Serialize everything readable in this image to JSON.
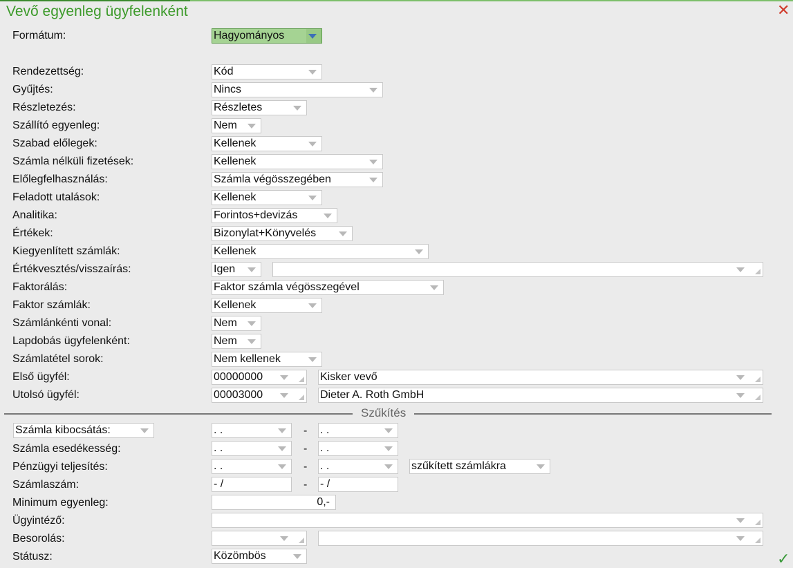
{
  "window": {
    "title": "Vevő egyenleg ügyfelenként"
  },
  "format": {
    "label": "Formátum:",
    "value": "Hagyományos"
  },
  "rows": [
    {
      "label": "Rendezettség:",
      "value": "Kód"
    },
    {
      "label": "Gyűjtés:",
      "value": "Nincs"
    },
    {
      "label": "Részletezés:",
      "value": "Részletes"
    },
    {
      "label": "Szállító egyenleg:",
      "value": "Nem"
    },
    {
      "label": "Szabad előlegek:",
      "value": "Kellenek"
    },
    {
      "label": "Számla nélküli fizetések:",
      "value": "Kellenek"
    },
    {
      "label": "Előlegfelhasználás:",
      "value": "Számla végösszegében"
    },
    {
      "label": "Feladott utalások:",
      "value": "Kellenek"
    },
    {
      "label": "Analitika:",
      "value": "Forintos+devizás"
    },
    {
      "label": "Értékek:",
      "value": "Bizonylat+Könyvelés"
    },
    {
      "label": "Kiegyenlített számlák:",
      "value": "Kellenek"
    },
    {
      "label": "Értékvesztés/visszaírás:",
      "value": "Igen",
      "extra": ""
    },
    {
      "label": "Faktorálás:",
      "value": "Faktor számla végösszegével"
    },
    {
      "label": "Faktor számlák:",
      "value": "Kellenek"
    },
    {
      "label": "Számlánkénti vonal:",
      "value": "Nem"
    },
    {
      "label": "Lapdobás ügyfelenként:",
      "value": "Nem"
    },
    {
      "label": "Számlatétel sorok:",
      "value": "Nem kellenek"
    },
    {
      "label": "Első ügyfél:",
      "code": "00000000",
      "name": "Kisker vevő"
    },
    {
      "label": "Utolsó ügyfél:",
      "code": "00003000",
      "name": "Dieter A. Roth GmbH"
    }
  ],
  "filter": {
    "title": "Szűkítés",
    "invoice_issue": {
      "label": "Számla kibocsátás:",
      "from": ". .",
      "to": ". ."
    },
    "invoice_due": {
      "label": "Számla esedékesség:",
      "from": ". .",
      "to": ". ."
    },
    "fin_completion": {
      "label": "Pénzügyi teljesítés:",
      "from": ". .",
      "to": ". .",
      "scope": "szűkített számlákra"
    },
    "invoice_no": {
      "label": "Számlaszám:",
      "from": "- /",
      "to": "- /"
    },
    "min_balance": {
      "label": "Minimum egyenleg:",
      "value": "0,-"
    },
    "agent": {
      "label": "Ügyintéző:",
      "value": ""
    },
    "classification": {
      "label": "Besorolás:",
      "code": "",
      "name": ""
    },
    "status": {
      "label": "Státusz:",
      "value": "Közömbös"
    },
    "dash": "-"
  }
}
